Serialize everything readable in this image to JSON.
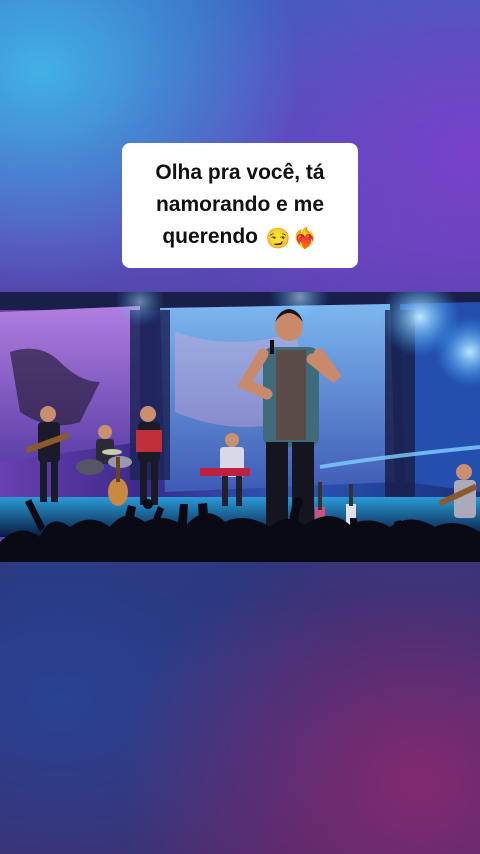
{
  "caption": {
    "line1": "Olha pra você, tá",
    "line2": "namorando e me",
    "line3": "querendo",
    "emoji1": "😏",
    "emoji2": "❤️‍🔥"
  },
  "video": {
    "icon": "concert-scene"
  },
  "colors": {
    "caption_bg": "#ffffff",
    "caption_text": "#111111",
    "stage_light": "#2fa8ff"
  }
}
